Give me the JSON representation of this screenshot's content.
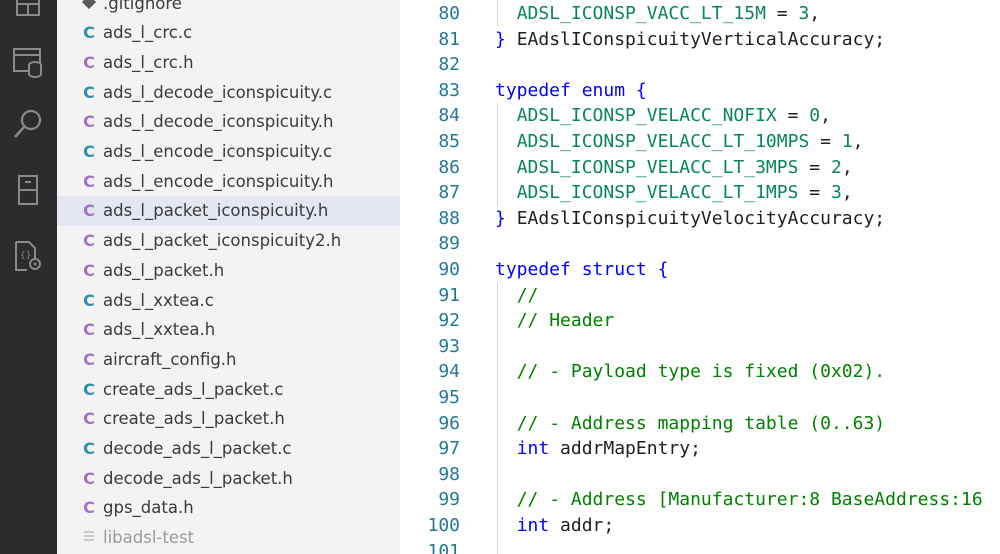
{
  "activity_bar": {
    "icons": [
      "explorer-icon",
      "database-icon",
      "search-icon",
      "device-icon",
      "settings-file-icon"
    ]
  },
  "explorer": {
    "files": [
      {
        "icon": "",
        "name": ".gitignore",
        "kind": "git"
      },
      {
        "icon": "C",
        "name": "ads_l_crc.c",
        "kind": "c"
      },
      {
        "icon": "C",
        "name": "ads_l_crc.h",
        "kind": "h"
      },
      {
        "icon": "C",
        "name": "ads_l_decode_iconspicuity.c",
        "kind": "c"
      },
      {
        "icon": "C",
        "name": "ads_l_decode_iconspicuity.h",
        "kind": "h"
      },
      {
        "icon": "C",
        "name": "ads_l_encode_iconspicuity.c",
        "kind": "c"
      },
      {
        "icon": "C",
        "name": "ads_l_encode_iconspicuity.h",
        "kind": "h"
      },
      {
        "icon": "C",
        "name": "ads_l_packet_iconspicuity.h",
        "kind": "h",
        "selected": true
      },
      {
        "icon": "C",
        "name": "ads_l_packet_iconspicuity2.h",
        "kind": "h"
      },
      {
        "icon": "C",
        "name": "ads_l_packet.h",
        "kind": "h"
      },
      {
        "icon": "C",
        "name": "ads_l_xxtea.c",
        "kind": "c"
      },
      {
        "icon": "C",
        "name": "ads_l_xxtea.h",
        "kind": "h"
      },
      {
        "icon": "C",
        "name": "aircraft_config.h",
        "kind": "h"
      },
      {
        "icon": "C",
        "name": "create_ads_l_packet.c",
        "kind": "c"
      },
      {
        "icon": "C",
        "name": "create_ads_l_packet.h",
        "kind": "h"
      },
      {
        "icon": "C",
        "name": "decode_ads_l_packet.c",
        "kind": "c"
      },
      {
        "icon": "C",
        "name": "decode_ads_l_packet.h",
        "kind": "h"
      },
      {
        "icon": "C",
        "name": "gps_data.h",
        "kind": "h"
      },
      {
        "icon": "",
        "name": "libadsl-test",
        "kind": "dim"
      }
    ]
  },
  "editor": {
    "lines": [
      {
        "n": "80",
        "tokens": [
          [
            "  ",
            "plain"
          ],
          [
            "ADSL_ICONSP_VACC_LT_15M",
            "enum"
          ],
          [
            " = ",
            "plain"
          ],
          [
            "3",
            "num"
          ],
          [
            ",",
            "plain"
          ]
        ]
      },
      {
        "n": "81",
        "tokens": [
          [
            "} ",
            "kw"
          ],
          [
            "EAdslIConspicuityVerticalAccuracy;",
            "plain"
          ]
        ]
      },
      {
        "n": "82",
        "tokens": []
      },
      {
        "n": "83",
        "tokens": [
          [
            "typedef",
            "kw"
          ],
          [
            " ",
            "plain"
          ],
          [
            "enum",
            "kw"
          ],
          [
            " {",
            "kw"
          ]
        ]
      },
      {
        "n": "84",
        "tokens": [
          [
            "  ",
            "plain"
          ],
          [
            "ADSL_ICONSP_VELACC_NOFIX",
            "enum"
          ],
          [
            " = ",
            "plain"
          ],
          [
            "0",
            "num"
          ],
          [
            ",",
            "plain"
          ]
        ]
      },
      {
        "n": "85",
        "tokens": [
          [
            "  ",
            "plain"
          ],
          [
            "ADSL_ICONSP_VELACC_LT_10MPS",
            "enum"
          ],
          [
            " = ",
            "plain"
          ],
          [
            "1",
            "num"
          ],
          [
            ",",
            "plain"
          ]
        ]
      },
      {
        "n": "86",
        "tokens": [
          [
            "  ",
            "plain"
          ],
          [
            "ADSL_ICONSP_VELACC_LT_3MPS",
            "enum"
          ],
          [
            " = ",
            "plain"
          ],
          [
            "2",
            "num"
          ],
          [
            ",",
            "plain"
          ]
        ]
      },
      {
        "n": "87",
        "tokens": [
          [
            "  ",
            "plain"
          ],
          [
            "ADSL_ICONSP_VELACC_LT_1MPS",
            "enum"
          ],
          [
            " = ",
            "plain"
          ],
          [
            "3",
            "num"
          ],
          [
            ",",
            "plain"
          ]
        ]
      },
      {
        "n": "88",
        "tokens": [
          [
            "} ",
            "kw"
          ],
          [
            "EAdslIConspicuityVelocityAccuracy;",
            "plain"
          ]
        ]
      },
      {
        "n": "89",
        "tokens": []
      },
      {
        "n": "90",
        "tokens": [
          [
            "typedef",
            "kw"
          ],
          [
            " ",
            "plain"
          ],
          [
            "struct",
            "kw"
          ],
          [
            " {",
            "kw"
          ]
        ]
      },
      {
        "n": "91",
        "tokens": [
          [
            "  ",
            "plain"
          ],
          [
            "//",
            "cmt"
          ]
        ]
      },
      {
        "n": "92",
        "tokens": [
          [
            "  ",
            "plain"
          ],
          [
            "// Header",
            "cmt"
          ]
        ]
      },
      {
        "n": "93",
        "tokens": []
      },
      {
        "n": "94",
        "tokens": [
          [
            "  ",
            "plain"
          ],
          [
            "// - Payload type is fixed (0x02).",
            "cmt"
          ]
        ]
      },
      {
        "n": "95",
        "tokens": []
      },
      {
        "n": "96",
        "tokens": [
          [
            "  ",
            "plain"
          ],
          [
            "// - Address mapping table (0..63)",
            "cmt"
          ]
        ]
      },
      {
        "n": "97",
        "tokens": [
          [
            "  ",
            "plain"
          ],
          [
            "int",
            "kw"
          ],
          [
            " addrMapEntry;",
            "plain"
          ]
        ]
      },
      {
        "n": "98",
        "tokens": []
      },
      {
        "n": "99",
        "tokens": [
          [
            "  ",
            "plain"
          ],
          [
            "// - Address [Manufacturer:8 BaseAddress:16",
            "cmt"
          ]
        ]
      },
      {
        "n": "100",
        "tokens": [
          [
            "  ",
            "plain"
          ],
          [
            "int",
            "kw"
          ],
          [
            " addr;",
            "plain"
          ]
        ]
      },
      {
        "n": "101",
        "tokens": []
      }
    ]
  }
}
